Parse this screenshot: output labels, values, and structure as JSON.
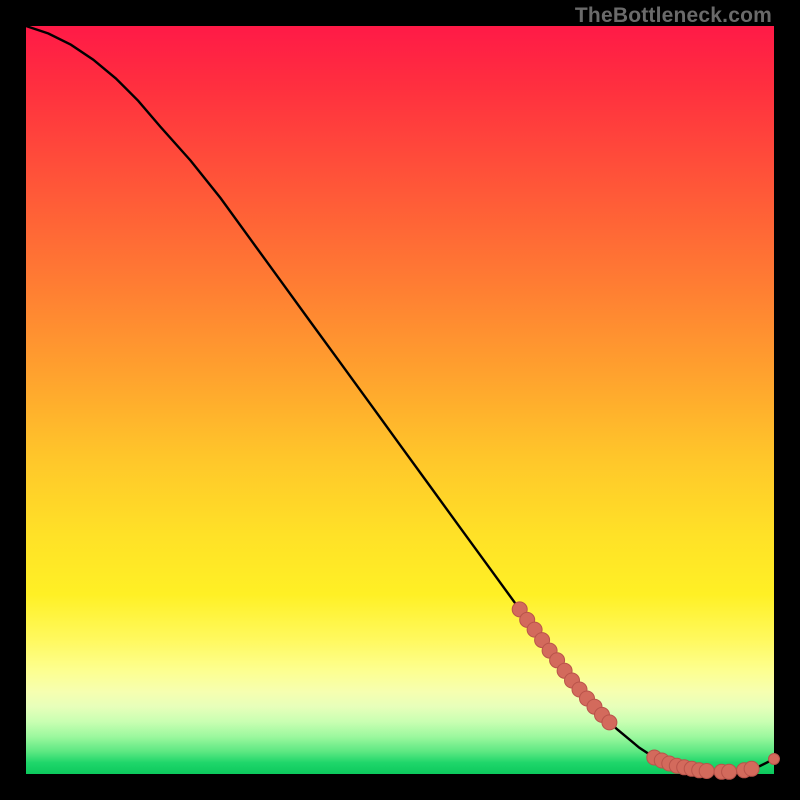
{
  "watermark": "TheBottleneck.com",
  "colors": {
    "background": "#000000",
    "curve": "#000000",
    "marker_fill": "#d36a5c",
    "marker_stroke": "#b9534a"
  },
  "chart_data": {
    "type": "line",
    "title": "",
    "xlabel": "",
    "ylabel": "",
    "xlim": [
      0,
      100
    ],
    "ylim": [
      0,
      100
    ],
    "grid": false,
    "legend": false,
    "series": [
      {
        "name": "curve",
        "x": [
          0,
          3,
          6,
          9,
          12,
          15,
          18,
          22,
          26,
          30,
          34,
          38,
          42,
          46,
          50,
          54,
          58,
          62,
          66,
          70,
          73,
          76,
          79,
          82,
          84,
          86,
          88,
          90,
          92,
          94,
          96,
          98,
          100
        ],
        "y": [
          100,
          99,
          97.5,
          95.5,
          93,
          90,
          86.5,
          82,
          77,
          71.5,
          66,
          60.5,
          55,
          49.5,
          44,
          38.5,
          33,
          27.5,
          22,
          16.5,
          12.5,
          9,
          6,
          3.5,
          2.2,
          1.4,
          0.9,
          0.5,
          0.3,
          0.3,
          0.5,
          1.0,
          2.0
        ]
      }
    ],
    "markers": [
      {
        "name": "segment-upper",
        "x": [
          66,
          67,
          68,
          69,
          70,
          71
        ],
        "y": [
          22,
          20.6,
          19.3,
          17.9,
          16.5,
          15.2
        ]
      },
      {
        "name": "segment-mid",
        "x": [
          72,
          73,
          74,
          75,
          76,
          77,
          78
        ],
        "y": [
          13.8,
          12.5,
          11.3,
          10.1,
          9.0,
          7.9,
          6.9
        ]
      },
      {
        "name": "cluster-flat",
        "x": [
          84,
          85,
          86,
          87,
          88,
          89,
          90,
          91,
          93,
          94,
          96,
          97
        ],
        "y": [
          2.2,
          1.8,
          1.4,
          1.1,
          0.9,
          0.7,
          0.5,
          0.4,
          0.3,
          0.3,
          0.5,
          0.7
        ]
      },
      {
        "name": "end-point",
        "x": [
          100
        ],
        "y": [
          2.0
        ]
      }
    ]
  }
}
